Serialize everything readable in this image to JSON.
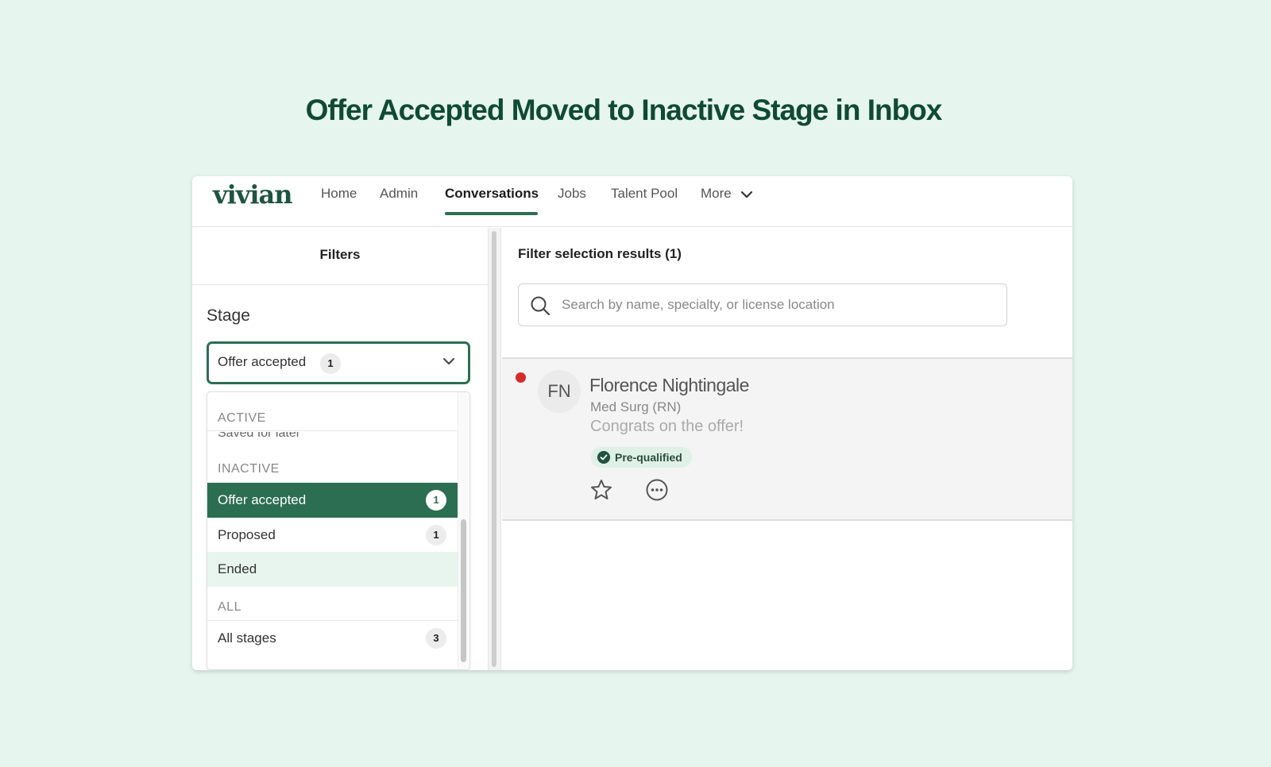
{
  "headline": "Offer Accepted Moved to Inactive Stage in Inbox",
  "nav": {
    "logo": "vivian",
    "items": [
      {
        "label": "Home"
      },
      {
        "label": "Admin"
      },
      {
        "label": "Conversations"
      },
      {
        "label": "Jobs"
      },
      {
        "label": "Talent Pool"
      },
      {
        "label": "More"
      }
    ],
    "active": "Conversations"
  },
  "filters": {
    "title": "Filters",
    "stage_label": "Stage",
    "selected": {
      "label": "Offer accepted",
      "count": "1"
    },
    "dropdown": {
      "group_active": "ACTIVE",
      "cut_item": "Saved for later",
      "group_inactive": "INACTIVE",
      "options": [
        {
          "label": "Offer accepted",
          "count": "1"
        },
        {
          "label": "Proposed",
          "count": "1"
        },
        {
          "label": "Ended",
          "count": ""
        }
      ],
      "group_all": "ALL",
      "all_option": {
        "label": "All stages",
        "count": "3"
      }
    }
  },
  "results": {
    "title": "Filter selection results (1)",
    "search_placeholder": "Search by name, specialty, or license location",
    "conversation": {
      "initials": "FN",
      "name": "Florence Nightingale",
      "role": "Med Surg (RN)",
      "message": "Congrats on the offer!",
      "tag": "Pre-qualified"
    }
  },
  "colors": {
    "accent": "#2c6e52",
    "headline": "#0f4a34",
    "unread": "#d62b2b",
    "background": "#e6f5ee"
  }
}
